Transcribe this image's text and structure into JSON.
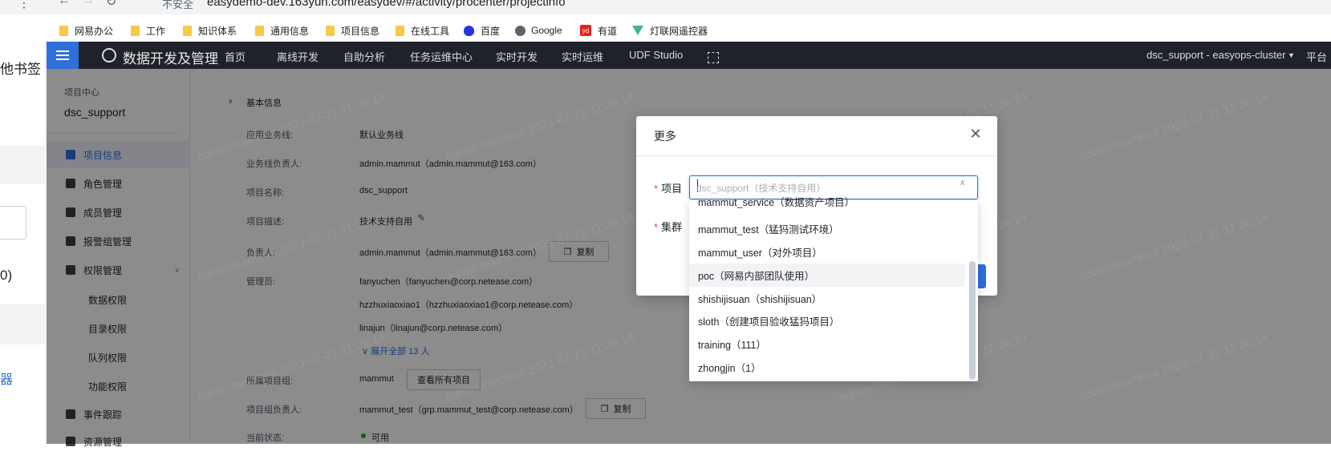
{
  "browser": {
    "security_label": "不安全",
    "url": "easydemo-dev.163yun.com/easydev/#/activity/procenter/projectinfo",
    "bookmarks": [
      {
        "label": "网易办公",
        "icon": "folder-icon"
      },
      {
        "label": "工作",
        "icon": "folder-icon"
      },
      {
        "label": "知识体系",
        "icon": "folder-icon"
      },
      {
        "label": "通用信息",
        "icon": "folder-icon"
      },
      {
        "label": "项目信息",
        "icon": "folder-icon"
      },
      {
        "label": "在线工具",
        "icon": "folder-icon"
      },
      {
        "label": "百度",
        "icon": "baidu-icon"
      },
      {
        "label": "Google",
        "icon": "google-icon"
      },
      {
        "label": "有道",
        "icon": "youdao-icon"
      },
      {
        "label": "灯联网遥控器",
        "icon": "vue-icon"
      }
    ],
    "left_fragment_1": "他书签",
    "left_fragment_2": "0)",
    "left_fragment_3": "器"
  },
  "app": {
    "title": "数据开发及管理",
    "nav": [
      "首页",
      "离线开发",
      "自助分析",
      "任务运维中心",
      "实时开发",
      "实时运维",
      "UDF Studio"
    ],
    "cluster": "dsc_support - easyops-cluster",
    "platform": "平台"
  },
  "sidebar": {
    "section_title": "项目中心",
    "project": "dsc_support",
    "items": [
      {
        "label": "项目信息",
        "active": true
      },
      {
        "label": "角色管理"
      },
      {
        "label": "成员管理"
      },
      {
        "label": "报警组管理"
      },
      {
        "label": "权限管理"
      }
    ],
    "subitems": [
      "数据权限",
      "目录权限",
      "队列权限",
      "功能权限"
    ],
    "after": [
      "事件跟踪",
      "资源管理"
    ]
  },
  "main": {
    "section": "基本信息",
    "rows": [
      {
        "label": "应用业务线:",
        "value": "默认业务线"
      },
      {
        "label": "业务线负责人:",
        "value": "admin.mammut（admin.mammut@163.com）"
      },
      {
        "label": "项目名称:",
        "value": "dsc_support"
      },
      {
        "label": "项目描述:",
        "value": "技术支持自用"
      },
      {
        "label": "负责人:",
        "value": "admin.mammut（admin.mammut@163.com）"
      },
      {
        "label": "管理员:",
        "value": "fanyuchen（fanyuchen@corp.netease.com）"
      },
      {
        "label": "",
        "value": "hzzhuxiaoxiao1（hzzhuxiaoxiao1@corp.netease.com）"
      },
      {
        "label": "",
        "value": "linajun（linajun@corp.netease.com）"
      },
      {
        "label": "所属项目组:",
        "value": "mammut"
      },
      {
        "label": "项目组负责人:",
        "value": "mammut_test（grp.mammut_test@corp.netease.com）"
      },
      {
        "label": "当前状态:",
        "value": "可用"
      }
    ],
    "expand_label": "展开全部 13 人",
    "copy_label": "复制",
    "view_all_label": "查看所有项目"
  },
  "modal": {
    "title": "更多",
    "project_label": "项目",
    "cluster_label": "集群",
    "select_placeholder": "dsc_support（技术支持自用）",
    "options": [
      {
        "label": "mammut_service（数据资产项目）"
      },
      {
        "label": "mammut_test（猛犸测试环境）"
      },
      {
        "label": "mammut_user（对外项目）"
      },
      {
        "label": "poc（网易内部团队使用）",
        "highlighted": true
      },
      {
        "label": "shishijisuan（shishijisuan）"
      },
      {
        "label": "sloth（创建项目验收猛犸项目）"
      },
      {
        "label": "training（111）"
      },
      {
        "label": "zhongjin（1）"
      }
    ]
  },
  "watermark": "admin.mammut 2023-07-21 11:26:14",
  "colors": {
    "accent": "#2e6fd8",
    "nav_bg": "#1f2329",
    "required": "#f53f3f",
    "status_ok": "#00b42a"
  }
}
